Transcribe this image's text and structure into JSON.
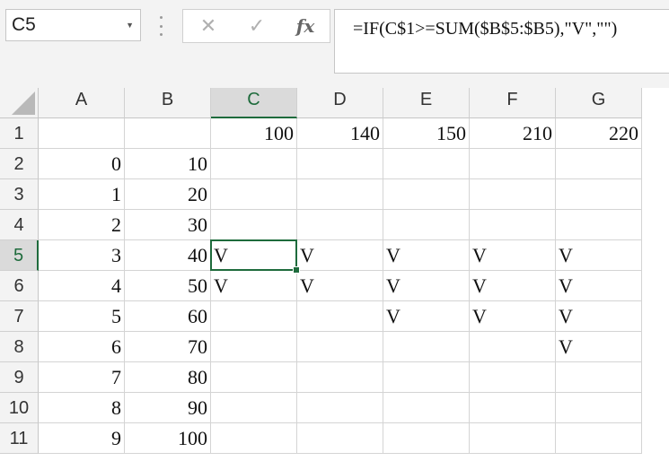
{
  "name_box": {
    "value": "C5",
    "dropdown_icon": "caret-down-icon"
  },
  "formula_bar": {
    "cancel_icon": "✕",
    "enter_icon": "✓",
    "fx_label": "fx",
    "formula": "=IF(C$1>=SUM($B$5:$B5),\"V\",\"\")"
  },
  "sheet": {
    "active_cell": "C5",
    "columns": [
      "A",
      "B",
      "C",
      "D",
      "E",
      "F",
      "G"
    ],
    "rows": [
      "1",
      "2",
      "3",
      "4",
      "5",
      "6",
      "7",
      "8",
      "9",
      "10",
      "11"
    ],
    "cells": [
      [
        "",
        "",
        "100",
        "140",
        "150",
        "210",
        "220"
      ],
      [
        "0",
        "10",
        "",
        "",
        "",
        "",
        ""
      ],
      [
        "1",
        "20",
        "",
        "",
        "",
        "",
        ""
      ],
      [
        "2",
        "30",
        "",
        "",
        "",
        "",
        ""
      ],
      [
        "3",
        "40",
        "V",
        "V",
        "V",
        "V",
        "V"
      ],
      [
        "4",
        "50",
        "V",
        "V",
        "V",
        "V",
        "V"
      ],
      [
        "5",
        "60",
        "",
        "",
        "V",
        "V",
        "V"
      ],
      [
        "6",
        "70",
        "",
        "",
        "",
        "",
        "V"
      ],
      [
        "7",
        "80",
        "",
        "",
        "",
        "",
        ""
      ],
      [
        "8",
        "90",
        "",
        "",
        "",
        "",
        ""
      ],
      [
        "9",
        "100",
        "",
        "",
        "",
        "",
        ""
      ]
    ]
  },
  "colors": {
    "accent": "#1e6b3c",
    "header_bg": "#f3f3f3",
    "gridline": "#d4d4d4"
  }
}
